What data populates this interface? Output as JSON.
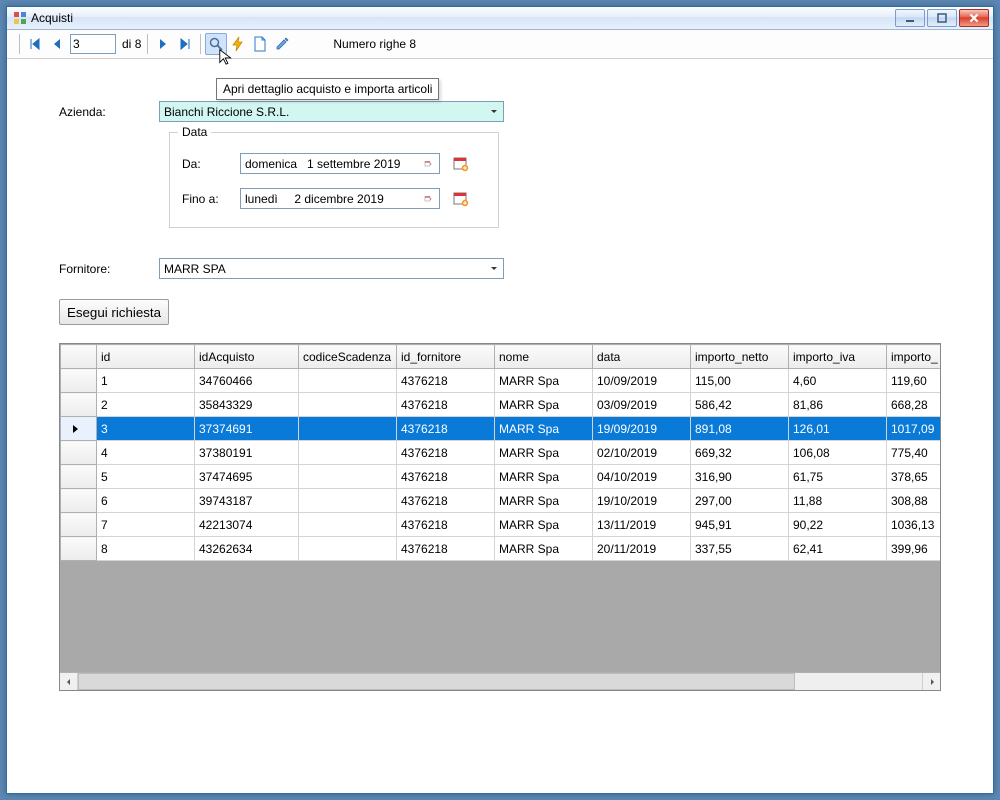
{
  "window": {
    "title": "Acquisti"
  },
  "toolbar": {
    "nav_value": "3",
    "nav_of_prefix": "di",
    "nav_of_total": "8",
    "row_count_label": "Numero righe 8"
  },
  "tooltip": {
    "text": "Apri dettaglio acquisto e importa articoli"
  },
  "form": {
    "azienda_label": "Azienda:",
    "azienda_value": "Bianchi Riccione S.R.L.",
    "fornitore_label": "Fornitore:",
    "fornitore_value": "MARR SPA",
    "data_group": "Data",
    "da_label": "Da:",
    "da_value": "domenica   1 settembre 2019",
    "fino_label": "Fino a:",
    "fino_value": "lunedì     2 dicembre 2019",
    "execute_label": "Esegui richiesta"
  },
  "grid": {
    "columns": [
      "id",
      "idAcquisto",
      "codiceScadenza",
      "id_fornitore",
      "nome",
      "data",
      "importo_netto",
      "importo_iva",
      "importo_"
    ],
    "rows": [
      {
        "id": "1",
        "idAcquisto": "34760466",
        "codiceScadenza": "",
        "id_fornitore": "4376218",
        "nome": "MARR Spa",
        "data": "10/09/2019",
        "importo_netto": "115,00",
        "importo_iva": "4,60",
        "importo": "119,60"
      },
      {
        "id": "2",
        "idAcquisto": "35843329",
        "codiceScadenza": "",
        "id_fornitore": "4376218",
        "nome": "MARR Spa",
        "data": "03/09/2019",
        "importo_netto": "586,42",
        "importo_iva": "81,86",
        "importo": "668,28"
      },
      {
        "id": "3",
        "idAcquisto": "37374691",
        "codiceScadenza": "",
        "id_fornitore": "4376218",
        "nome": "MARR Spa",
        "data": "19/09/2019",
        "importo_netto": "891,08",
        "importo_iva": "126,01",
        "importo": "1017,09",
        "selected": true
      },
      {
        "id": "4",
        "idAcquisto": "37380191",
        "codiceScadenza": "",
        "id_fornitore": "4376218",
        "nome": "MARR Spa",
        "data": "02/10/2019",
        "importo_netto": "669,32",
        "importo_iva": "106,08",
        "importo": "775,40"
      },
      {
        "id": "5",
        "idAcquisto": "37474695",
        "codiceScadenza": "",
        "id_fornitore": "4376218",
        "nome": "MARR Spa",
        "data": "04/10/2019",
        "importo_netto": "316,90",
        "importo_iva": "61,75",
        "importo": "378,65"
      },
      {
        "id": "6",
        "idAcquisto": "39743187",
        "codiceScadenza": "",
        "id_fornitore": "4376218",
        "nome": "MARR Spa",
        "data": "19/10/2019",
        "importo_netto": "297,00",
        "importo_iva": "11,88",
        "importo": "308,88"
      },
      {
        "id": "7",
        "idAcquisto": "42213074",
        "codiceScadenza": "",
        "id_fornitore": "4376218",
        "nome": "MARR Spa",
        "data": "13/11/2019",
        "importo_netto": "945,91",
        "importo_iva": "90,22",
        "importo": "1036,13"
      },
      {
        "id": "8",
        "idAcquisto": "43262634",
        "codiceScadenza": "",
        "id_fornitore": "4376218",
        "nome": "MARR Spa",
        "data": "20/11/2019",
        "importo_netto": "337,55",
        "importo_iva": "62,41",
        "importo": "399,96"
      }
    ]
  }
}
